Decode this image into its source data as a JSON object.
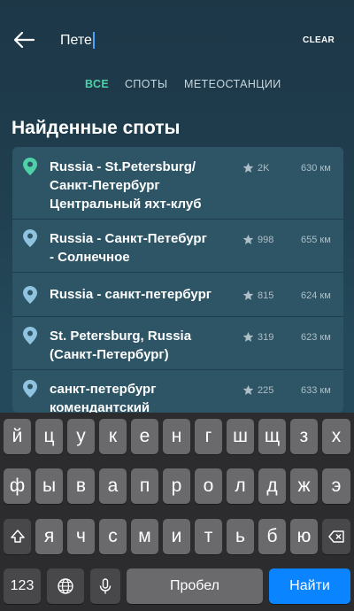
{
  "header": {
    "search_value": "Пете",
    "clear_label": "CLEAR"
  },
  "tabs": {
    "all": "ВСЕ",
    "spots": "СПОТЫ",
    "stations": "МЕТЕОСТАНЦИИ",
    "active": "all"
  },
  "section_title": "Найденные споты",
  "accent_color": "#4fd1a8",
  "results": [
    {
      "name_lines": [
        "Russia - St.Petersburg/",
        "Санкт-Петербург",
        "Центральный яхт-клуб"
      ],
      "rating": "2K",
      "distance": "630 км",
      "pin_color": "#4fd1a8",
      "icon": "map-pin-icon"
    },
    {
      "name_lines": [
        "Russia - Санкт-Петебург",
        "- Солнечное"
      ],
      "rating": "998",
      "distance": "655 км",
      "pin_color": "#8fc3e0",
      "icon": "map-pin-icon"
    },
    {
      "name_lines": [
        "Russia - санкт-петербург"
      ],
      "rating": "815",
      "distance": "624 км",
      "pin_color": "#8fc3e0",
      "icon": "map-pin-icon"
    },
    {
      "name_lines": [
        "St. Petersburg, Russia",
        "(Санкт-Петербург)"
      ],
      "rating": "319",
      "distance": "623 км",
      "pin_color": "#8fc3e0",
      "icon": "map-pin-icon"
    },
    {
      "name_lines": [
        "санкт-петербург",
        "комендантский"
      ],
      "rating": "225",
      "distance": "633 км",
      "pin_color": "#8fc3e0",
      "icon": "map-pin-icon"
    }
  ],
  "keyboard": {
    "row1": [
      "й",
      "ц",
      "у",
      "к",
      "е",
      "н",
      "г",
      "ш",
      "щ",
      "з",
      "х"
    ],
    "row2": [
      "ф",
      "ы",
      "в",
      "а",
      "п",
      "р",
      "о",
      "л",
      "д",
      "ж",
      "э"
    ],
    "row3": [
      "я",
      "ч",
      "с",
      "м",
      "и",
      "т",
      "ь",
      "б",
      "ю"
    ],
    "numbers_label": "123",
    "space_label": "Пробел",
    "go_label": "Найти",
    "icons": [
      "shift-icon",
      "backspace-icon",
      "globe-icon",
      "microphone-icon"
    ]
  }
}
